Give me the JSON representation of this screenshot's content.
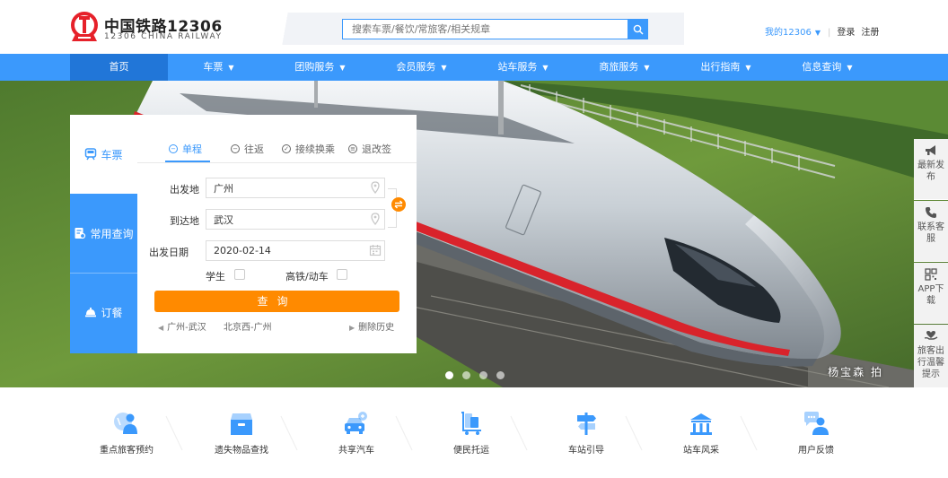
{
  "header": {
    "brand_cn": "中国铁路12306",
    "brand_en": "12306 CHINA RAILWAY",
    "search_placeholder": "搜索车票/餐饮/常旅客/相关规章",
    "my_account": "我的12306",
    "login": "登录",
    "register": "注册"
  },
  "nav": {
    "items": [
      {
        "label": "首页",
        "dropdown": false,
        "active": true
      },
      {
        "label": "车票",
        "dropdown": true
      },
      {
        "label": "团购服务",
        "dropdown": true
      },
      {
        "label": "会员服务",
        "dropdown": true
      },
      {
        "label": "站车服务",
        "dropdown": true
      },
      {
        "label": "商旅服务",
        "dropdown": true
      },
      {
        "label": "出行指南",
        "dropdown": true
      },
      {
        "label": "信息查询",
        "dropdown": true
      }
    ]
  },
  "banner": {
    "photo_credit": "杨宝森 拍",
    "slide_count": 4,
    "active_slide": 0
  },
  "panel": {
    "side_tabs": [
      {
        "label": "车票",
        "icon": "train-icon",
        "active": true
      },
      {
        "label": "常用查询",
        "icon": "document-search-icon"
      },
      {
        "label": "订餐",
        "icon": "food-cover-icon"
      }
    ],
    "trip_tabs": [
      {
        "label": "单程",
        "active": true
      },
      {
        "label": "往返"
      },
      {
        "label": "接续换乘"
      },
      {
        "label": "退改签"
      }
    ],
    "from_label": "出发地",
    "from_value": "广州",
    "to_label": "到达地",
    "to_value": "武汉",
    "date_label": "出发日期",
    "date_value": "2020-02-14",
    "student_label": "学生",
    "highspeed_label": "高铁/动车",
    "query_label": "查询",
    "history": [
      "广州-武汉",
      "北京西-广州"
    ],
    "clear_history": "删除历史"
  },
  "float_bar": [
    {
      "label": "最新发布",
      "icon": "megaphone-icon"
    },
    {
      "label": "联系客服",
      "icon": "phone-icon"
    },
    {
      "label": "APP下载",
      "icon": "qr-code-icon"
    },
    {
      "label": "旅客出行温馨提示",
      "icon": "heart-hand-icon"
    }
  ],
  "services": [
    {
      "label": "重点旅客预约",
      "icon": "assisted-passenger-icon"
    },
    {
      "label": "遗失物品查找",
      "icon": "lost-found-box-icon"
    },
    {
      "label": "共享汽车",
      "icon": "shared-car-icon"
    },
    {
      "label": "便民托运",
      "icon": "luggage-cart-icon"
    },
    {
      "label": "车站引导",
      "icon": "signpost-icon"
    },
    {
      "label": "站车风采",
      "icon": "station-building-icon"
    },
    {
      "label": "用户反馈",
      "icon": "feedback-user-icon"
    }
  ],
  "colors": {
    "primary": "#3b99fc",
    "nav_active": "#2176d8",
    "accent_orange": "#ff8a00",
    "brand_red": "#e6212a"
  }
}
